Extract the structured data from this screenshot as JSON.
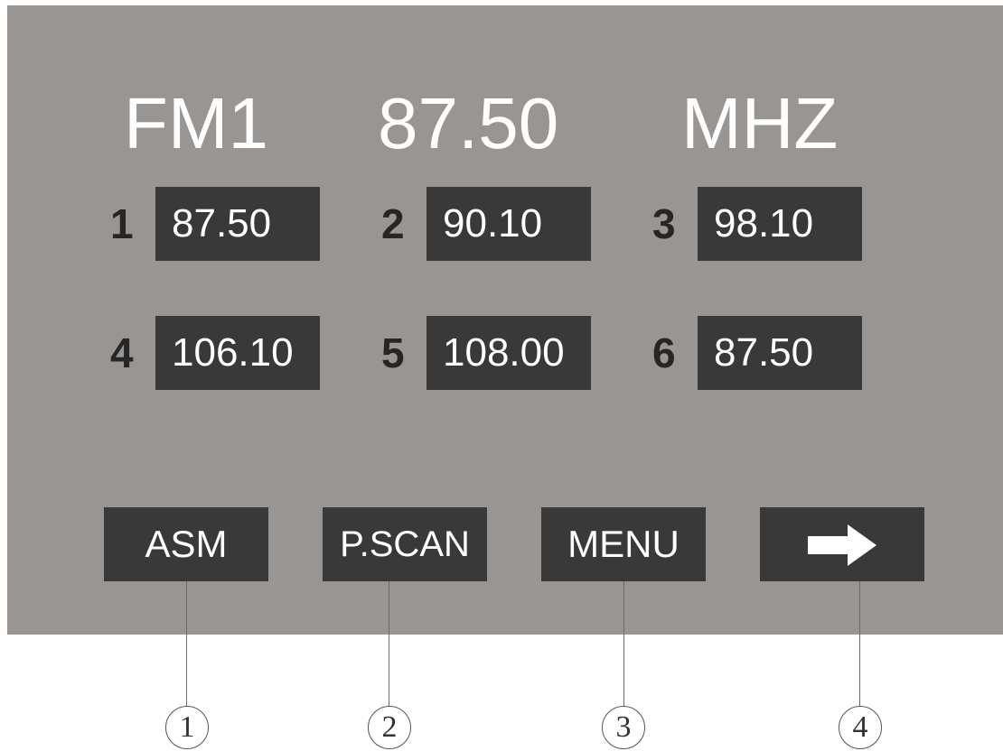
{
  "display": {
    "band": "FM1",
    "frequency": "87.50",
    "unit": "MHZ"
  },
  "presets": [
    {
      "number": "1",
      "frequency": "87.50"
    },
    {
      "number": "2",
      "frequency": "90.10"
    },
    {
      "number": "3",
      "frequency": "98.10"
    },
    {
      "number": "4",
      "frequency": "106.10"
    },
    {
      "number": "5",
      "frequency": "108.00"
    },
    {
      "number": "6",
      "frequency": "87.50"
    }
  ],
  "buttons": {
    "asm": "ASM",
    "pscan": "P.SCAN",
    "menu": "MENU",
    "next_icon": "arrow-right-icon"
  },
  "callouts": [
    "1",
    "2",
    "3",
    "4"
  ],
  "colors": {
    "screen_bg": "#989592",
    "button_bg": "#3a3939",
    "text_light": "#ffffff",
    "preset_number": "#262626"
  }
}
